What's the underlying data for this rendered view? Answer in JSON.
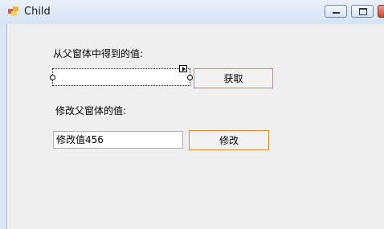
{
  "window": {
    "title": "Child"
  },
  "form": {
    "get_label": "从父窗体中得到的值:",
    "get_value": "",
    "get_button": "获取",
    "modify_label": "修改父窗体的值:",
    "modify_value": "修改值456",
    "modify_button": "修改"
  },
  "colors": {
    "button_border": "#e58a2c",
    "client_bg": "#efefef",
    "frame_bg": "#dce7f5"
  }
}
